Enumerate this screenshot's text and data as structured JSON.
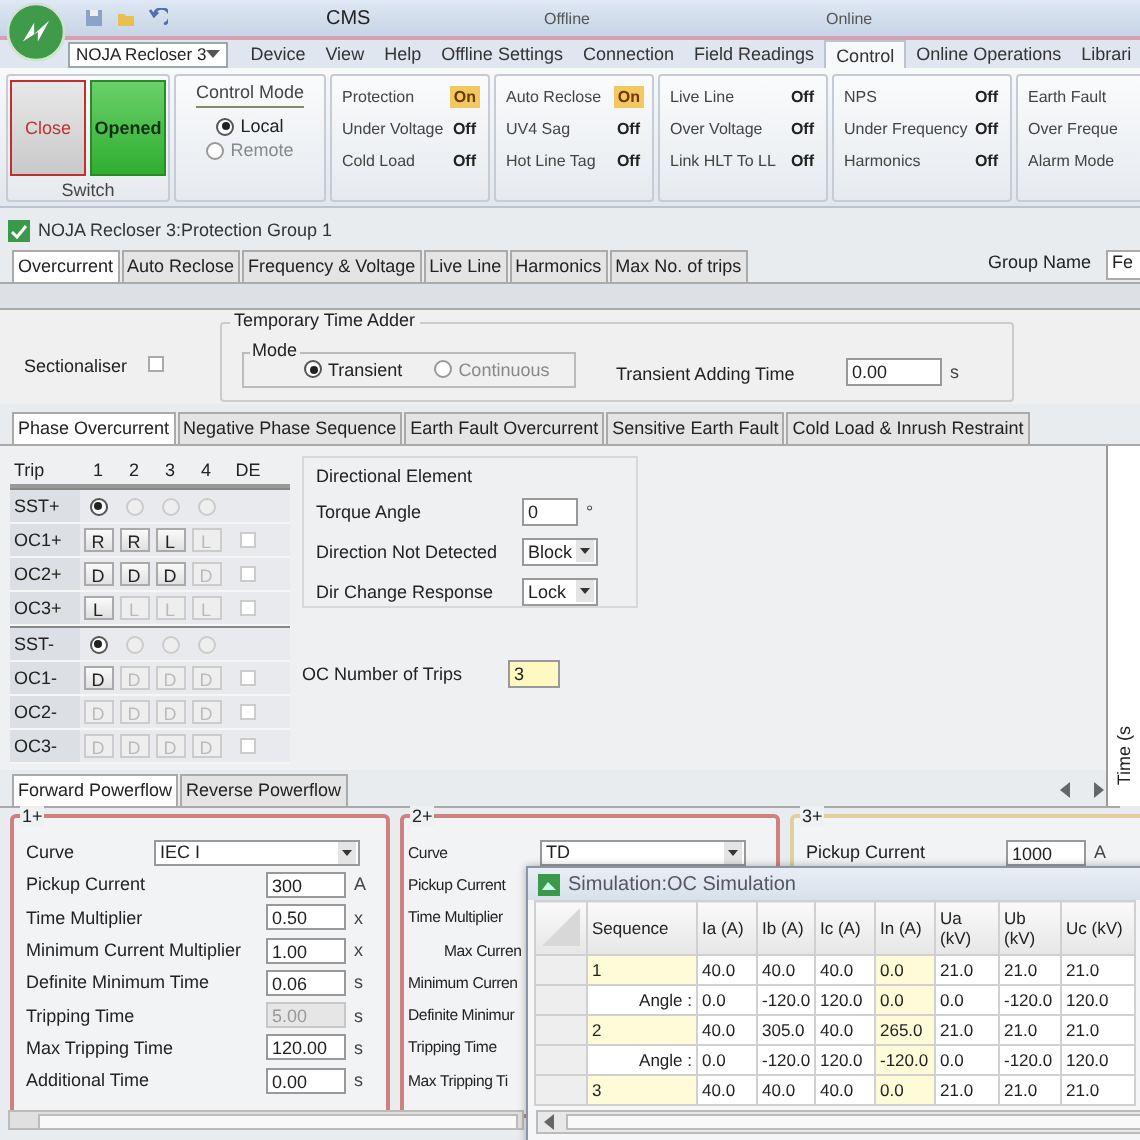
{
  "window": {
    "title": "CMS",
    "contexts": [
      {
        "label": "Offline"
      },
      {
        "label": "Online"
      }
    ]
  },
  "device_combo": {
    "value": "NOJA Recloser 3"
  },
  "ribbon_tabs": [
    {
      "label": "Device",
      "selected": false
    },
    {
      "label": "View",
      "selected": false
    },
    {
      "label": "Help",
      "selected": false
    },
    {
      "label": "Offline Settings",
      "selected": false
    },
    {
      "label": "Connection",
      "selected": false
    },
    {
      "label": "Field Readings",
      "selected": false
    },
    {
      "label": "Control",
      "selected": true
    },
    {
      "label": "Online Operations",
      "selected": false
    },
    {
      "label": "Librari",
      "selected": false
    }
  ],
  "switch_group": {
    "label": "Switch",
    "buttons": [
      {
        "label": "Close",
        "kind": "close"
      },
      {
        "label": "Opened",
        "kind": "opened"
      }
    ]
  },
  "control_mode": {
    "title": "Control Mode",
    "options": [
      {
        "label": "Local",
        "selected": true
      },
      {
        "label": "Remote",
        "selected": false
      }
    ]
  },
  "status_groups": [
    {
      "items": [
        {
          "label": "Protection",
          "value": "On",
          "on": true
        },
        {
          "label": "Under Voltage",
          "value": "Off",
          "on": false
        },
        {
          "label": "Cold Load",
          "value": "Off",
          "on": false
        }
      ]
    },
    {
      "items": [
        {
          "label": "Auto Reclose",
          "value": "On",
          "on": true
        },
        {
          "label": "UV4 Sag",
          "value": "Off",
          "on": false
        },
        {
          "label": "Hot Line Tag",
          "value": "Off",
          "on": false
        }
      ]
    },
    {
      "items": [
        {
          "label": "Live Line",
          "value": "Off",
          "on": false
        },
        {
          "label": "Over Voltage",
          "value": "Off",
          "on": false
        },
        {
          "label": "Link HLT To LL",
          "value": "Off",
          "on": false
        }
      ]
    },
    {
      "items": [
        {
          "label": "NPS",
          "value": "Off",
          "on": false
        },
        {
          "label": "Under Frequency",
          "value": "Off",
          "on": false
        },
        {
          "label": "Harmonics",
          "value": "Off",
          "on": false
        }
      ]
    },
    {
      "items": [
        {
          "label": "Earth Fault"
        },
        {
          "label": "Over Freque"
        },
        {
          "label": "Alarm Mode"
        }
      ]
    }
  ],
  "document": {
    "title": "NOJA Recloser 3:Protection Group 1"
  },
  "tabs": [
    {
      "label": "Overcurrent",
      "selected": true
    },
    {
      "label": "Auto Reclose",
      "selected": false
    },
    {
      "label": "Frequency & Voltage",
      "selected": false
    },
    {
      "label": "Live Line",
      "selected": false
    },
    {
      "label": "Harmonics",
      "selected": false
    },
    {
      "label": "Max No. of trips",
      "selected": false
    }
  ],
  "group_name": {
    "label": "Group Name",
    "value": "Fe"
  },
  "sectionaliser": {
    "label": "Sectionaliser",
    "checked": false
  },
  "time_adder": {
    "title": "Temporary Time Adder",
    "mode_title": "Mode",
    "modes": [
      {
        "label": "Transient",
        "selected": true
      },
      {
        "label": "Continuous",
        "selected": false
      }
    ],
    "field_label": "Transient Adding Time",
    "value": "0.00",
    "unit": "s"
  },
  "sub_tabs": [
    {
      "label": "Phase Overcurrent",
      "selected": true
    },
    {
      "label": "Negative Phase Sequence",
      "selected": false
    },
    {
      "label": "Earth Fault Overcurrent",
      "selected": false
    },
    {
      "label": "Sensitive Earth Fault",
      "selected": false
    },
    {
      "label": "Cold Load & Inrush Restraint",
      "selected": false
    }
  ],
  "trip_table": {
    "row_header_title": "Trip",
    "columns": [
      "1",
      "2",
      "3",
      "4",
      "DE"
    ],
    "rows": [
      {
        "label": "SST+",
        "kind": "radio",
        "cells": [
          {
            "kind": "radio",
            "selected": true,
            "disabled": false
          },
          {
            "kind": "radio",
            "selected": false,
            "disabled": true
          },
          {
            "kind": "radio",
            "selected": false,
            "disabled": true
          },
          {
            "kind": "radio",
            "selected": false,
            "disabled": true
          }
        ]
      },
      {
        "label": "OC1+",
        "kind": "buttons",
        "cells": [
          {
            "kind": "button",
            "text": "R",
            "disabled": false
          },
          {
            "kind": "button",
            "text": "R",
            "disabled": false
          },
          {
            "kind": "button",
            "text": "L",
            "disabled": false
          },
          {
            "kind": "button",
            "text": "L",
            "disabled": true
          },
          {
            "kind": "checkbox",
            "checked": false
          }
        ]
      },
      {
        "label": "OC2+",
        "kind": "buttons",
        "cells": [
          {
            "kind": "button",
            "text": "D",
            "disabled": false
          },
          {
            "kind": "button",
            "text": "D",
            "disabled": false
          },
          {
            "kind": "button",
            "text": "D",
            "disabled": false
          },
          {
            "kind": "button",
            "text": "D",
            "disabled": true
          },
          {
            "kind": "checkbox",
            "checked": false
          }
        ]
      },
      {
        "label": "OC3+",
        "kind": "buttons",
        "cells": [
          {
            "kind": "button",
            "text": "L",
            "disabled": false
          },
          {
            "kind": "button",
            "text": "L",
            "disabled": true
          },
          {
            "kind": "button",
            "text": "L",
            "disabled": true
          },
          {
            "kind": "button",
            "text": "L",
            "disabled": true
          },
          {
            "kind": "checkbox",
            "checked": false
          }
        ]
      },
      {
        "label": "SST-",
        "kind": "radio",
        "cells": [
          {
            "kind": "radio",
            "selected": true,
            "disabled": false
          },
          {
            "kind": "radio",
            "selected": false,
            "disabled": true
          },
          {
            "kind": "radio",
            "selected": false,
            "disabled": true
          },
          {
            "kind": "radio",
            "selected": false,
            "disabled": true
          }
        ]
      },
      {
        "label": "OC1-",
        "kind": "buttons",
        "cells": [
          {
            "kind": "button",
            "text": "D",
            "disabled": false
          },
          {
            "kind": "button",
            "text": "D",
            "disabled": true
          },
          {
            "kind": "button",
            "text": "D",
            "disabled": true
          },
          {
            "kind": "button",
            "text": "D",
            "disabled": true
          },
          {
            "kind": "checkbox",
            "checked": false
          }
        ]
      },
      {
        "label": "OC2-",
        "kind": "buttons",
        "cells": [
          {
            "kind": "button",
            "text": "D",
            "disabled": true
          },
          {
            "kind": "button",
            "text": "D",
            "disabled": true
          },
          {
            "kind": "button",
            "text": "D",
            "disabled": true
          },
          {
            "kind": "button",
            "text": "D",
            "disabled": true
          },
          {
            "kind": "checkbox",
            "checked": false
          }
        ]
      },
      {
        "label": "OC3-",
        "kind": "buttons",
        "cells": [
          {
            "kind": "button",
            "text": "D",
            "disabled": true
          },
          {
            "kind": "button",
            "text": "D",
            "disabled": true
          },
          {
            "kind": "button",
            "text": "D",
            "disabled": true
          },
          {
            "kind": "button",
            "text": "D",
            "disabled": true
          },
          {
            "kind": "checkbox",
            "checked": false
          }
        ]
      }
    ]
  },
  "directional_element": {
    "title": "Directional Element",
    "fields": [
      {
        "label": "Torque Angle",
        "value": "0",
        "unit": "°",
        "kind": "text"
      },
      {
        "label": "Direction Not Detected",
        "value": "Block",
        "kind": "select"
      },
      {
        "label": "Dir Change Response",
        "value": "Lock",
        "kind": "select"
      }
    ]
  },
  "oc_trips": {
    "label": "OC Number of Trips",
    "value": "3"
  },
  "chart_axis_label": "Time (s",
  "powerflow_tabs": [
    {
      "label": "Forward Powerflow",
      "selected": true
    },
    {
      "label": "Reverse Powerflow",
      "selected": false
    }
  ],
  "curve_panels": [
    {
      "title": "1+",
      "color": "#d08080",
      "fields": [
        {
          "label": "Curve",
          "value": "IEC I",
          "kind": "select",
          "disabled": false
        },
        {
          "label": "Pickup Current",
          "value": "300",
          "unit": "A",
          "kind": "text",
          "disabled": false
        },
        {
          "label": "Time Multiplier",
          "value": "0.50",
          "unit": "x",
          "kind": "text",
          "disabled": false
        },
        {
          "label": "Minimum Current Multiplier",
          "value": "1.00",
          "unit": "x",
          "kind": "text",
          "disabled": false
        },
        {
          "label": "Definite Minimum Time",
          "value": "0.06",
          "unit": "s",
          "kind": "text",
          "disabled": false
        },
        {
          "label": "Tripping Time",
          "value": "5.00",
          "unit": "s",
          "kind": "text",
          "disabled": true
        },
        {
          "label": "Max Tripping Time",
          "value": "120.00",
          "unit": "s",
          "kind": "text",
          "disabled": false
        },
        {
          "label": "Additional Time",
          "value": "0.00",
          "unit": "s",
          "kind": "text",
          "disabled": false
        }
      ]
    },
    {
      "title": "2+",
      "color": "#d08080",
      "fields": [
        {
          "label": "Curve",
          "value": "TD",
          "kind": "select"
        },
        {
          "label": "Pickup Current",
          "kind": "label"
        },
        {
          "label": "Time Multiplier",
          "kind": "label"
        },
        {
          "label": "Max Curren",
          "kind": "sublabel"
        },
        {
          "label": "Minimum Curren",
          "kind": "label"
        },
        {
          "label": "Definite Minimur",
          "kind": "label"
        },
        {
          "label": "Tripping Time",
          "kind": "label"
        },
        {
          "label": "Max Tripping Ti",
          "kind": "label"
        }
      ]
    },
    {
      "title": "3+",
      "color": "#e0d0a0",
      "fields": [
        {
          "label": "Pickup Current",
          "value": "1000",
          "unit": "A",
          "kind": "text"
        }
      ]
    }
  ],
  "simulation": {
    "title": "Simulation:OC Simulation",
    "columns": [
      {
        "label": "Sequence",
        "highlighted": false
      },
      {
        "label": "Ia (A)",
        "highlighted": false
      },
      {
        "label": "Ib (A)",
        "highlighted": false
      },
      {
        "label": "Ic (A)",
        "highlighted": false
      },
      {
        "label": "In (A)",
        "highlighted": true
      },
      {
        "label": "Ua (kV)",
        "highlighted": false
      },
      {
        "label": "Ub (kV)",
        "highlighted": false
      },
      {
        "label": "Uc (kV)",
        "highlighted": false
      }
    ],
    "rows": [
      {
        "kind": "value",
        "cells": [
          "1",
          "40.0",
          "40.0",
          "40.0",
          "0.0",
          "21.0",
          "21.0",
          "21.0"
        ]
      },
      {
        "kind": "angle",
        "cells": [
          "Angle :",
          "0.0",
          "-120.0",
          "120.0",
          "0.0",
          "0.0",
          "-120.0",
          "120.0"
        ]
      },
      {
        "kind": "value",
        "cells": [
          "2",
          "40.0",
          "305.0",
          "40.0",
          "265.0",
          "21.0",
          "21.0",
          "21.0"
        ]
      },
      {
        "kind": "angle",
        "cells": [
          "Angle :",
          "0.0",
          "-120.0",
          "120.0",
          "-120.0",
          "0.0",
          "-120.0",
          "120.0"
        ]
      },
      {
        "kind": "value",
        "cells": [
          "3",
          "40.0",
          "40.0",
          "40.0",
          "0.0",
          "21.0",
          "21.0",
          "21.0"
        ]
      }
    ]
  }
}
